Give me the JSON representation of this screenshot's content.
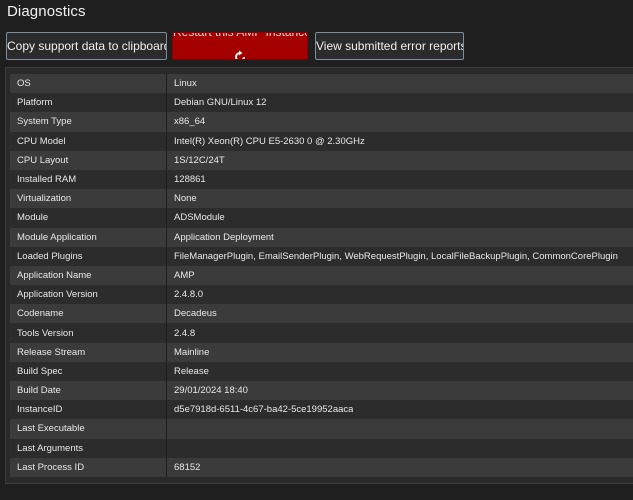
{
  "page": {
    "title": "Diagnostics"
  },
  "buttons": {
    "copy_label": "Copy support data to clipboard",
    "restart_label": "Restart this AMP Instance",
    "reports_label": "View submitted error reports"
  },
  "colors": {
    "background": "#1f1f1f",
    "danger": "#a50000",
    "row_odd": "#3b3b3b",
    "row_even": "#2c2c2c",
    "button_border": "#7a8ea0"
  },
  "icons": {
    "restart": "refresh-spinner-icon"
  },
  "diagnostics": [
    {
      "key": "OS",
      "value": "Linux"
    },
    {
      "key": "Platform",
      "value": "Debian GNU/Linux 12"
    },
    {
      "key": "System Type",
      "value": "x86_64"
    },
    {
      "key": "CPU Model",
      "value": "Intel(R) Xeon(R) CPU E5-2630 0 @ 2.30GHz"
    },
    {
      "key": "CPU Layout",
      "value": "1S/12C/24T"
    },
    {
      "key": "Installed RAM",
      "value": "128861"
    },
    {
      "key": "Virtualization",
      "value": "None"
    },
    {
      "key": "Module",
      "value": "ADSModule"
    },
    {
      "key": "Module Application",
      "value": "Application Deployment"
    },
    {
      "key": "Loaded Plugins",
      "value": "FileManagerPlugin, EmailSenderPlugin, WebRequestPlugin, LocalFileBackupPlugin, CommonCorePlugin"
    },
    {
      "key": "Application Name",
      "value": "AMP"
    },
    {
      "key": "Application Version",
      "value": "2.4.8.0"
    },
    {
      "key": "Codename",
      "value": "Decadeus"
    },
    {
      "key": "Tools Version",
      "value": "2.4.8"
    },
    {
      "key": "Release Stream",
      "value": "Mainline"
    },
    {
      "key": "Build Spec",
      "value": "Release"
    },
    {
      "key": "Build Date",
      "value": "29/01/2024 18:40"
    },
    {
      "key": "InstanceID",
      "value": "d5e7918d-6511-4c67-ba42-5ce19952aaca"
    },
    {
      "key": "Last Executable",
      "value": ""
    },
    {
      "key": "Last Arguments",
      "value": ""
    },
    {
      "key": "Last Process ID",
      "value": "68152"
    }
  ]
}
